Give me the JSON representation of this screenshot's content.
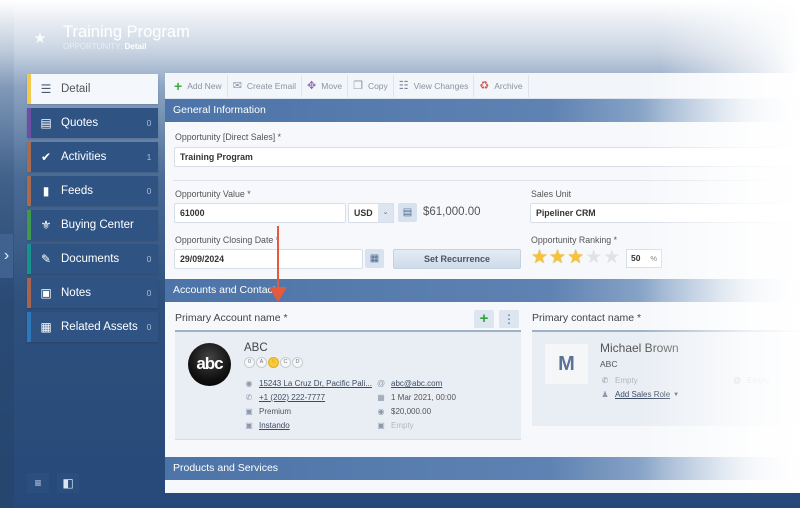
{
  "header": {
    "title": "Training Program",
    "subtitle_prefix": "OPPORTUNITY:",
    "subtitle_current": "Detail",
    "favorite_icon": "star-icon"
  },
  "sidebar": {
    "items": [
      {
        "label": "Detail",
        "count": "",
        "icon": "list-icon",
        "accent": "#f2c94c",
        "active": true
      },
      {
        "label": "Quotes",
        "count": "0",
        "icon": "quote-icon",
        "accent": "#6c4fa3"
      },
      {
        "label": "Activities",
        "count": "1",
        "icon": "chat-icon",
        "accent": "#a86b4f"
      },
      {
        "label": "Feeds",
        "count": "0",
        "icon": "feeds-icon",
        "accent": "#a86b4f"
      },
      {
        "label": "Buying Center",
        "count": "",
        "icon": "org-chart-icon",
        "accent": "#3f9a4d"
      },
      {
        "label": "Documents",
        "count": "0",
        "icon": "document-icon",
        "accent": "#16938d"
      },
      {
        "label": "Notes",
        "count": "0",
        "icon": "note-icon",
        "accent": "#a8644f"
      },
      {
        "label": "Related Assets",
        "count": "0",
        "icon": "assets-icon",
        "accent": "#2d78bd"
      }
    ],
    "bottom_icons": [
      "list-view-icon",
      "layout-edit-icon"
    ]
  },
  "toolbar": {
    "buttons": [
      {
        "label": "Add New",
        "icon": "plus-icon"
      },
      {
        "label": "Create Email",
        "icon": "email-icon"
      },
      {
        "label": "Move",
        "icon": "move-icon"
      },
      {
        "label": "Copy",
        "icon": "copy-icon"
      },
      {
        "label": "View Changes",
        "icon": "view-changes-icon"
      },
      {
        "label": "Archive",
        "icon": "archive-icon"
      }
    ]
  },
  "sections": {
    "general": "General Information",
    "accounts": "Accounts and Contacts",
    "products": "Products and Services"
  },
  "form": {
    "opportunity_label": "Opportunity [Direct Sales] *",
    "opportunity_value": "Training Program",
    "value_label": "Opportunity Value *",
    "value": "61000",
    "currency": "USD",
    "formatted_value": "$61,000.00",
    "sales_unit_label": "Sales Unit",
    "sales_unit": "Pipeliner CRM",
    "closing_date_label": "Opportunity Closing Date *",
    "closing_date": "29/09/2024",
    "set_recurrence": "Set Recurrence",
    "ranking_label": "Opportunity Ranking *",
    "ranking_stars_filled": 3,
    "ranking_stars_total": 5,
    "ranking_value": "50",
    "ranking_unit": "%"
  },
  "account": {
    "label": "Primary Account name *",
    "logo_text": "abc",
    "name": "ABC",
    "grades": [
      "0",
      "A",
      "B",
      "C",
      "D"
    ],
    "selected_grade": "B",
    "address": "15243 La Cruz Dr, Pacific Pali...",
    "phone": "+1 (202) 222-7777",
    "type": "Premium",
    "owner": "Instando",
    "email": "abc@abc.com",
    "date": "1 Mar 2021, 00:00",
    "revenue": "$20,000.00",
    "extra": "Empty"
  },
  "contact": {
    "label": "Primary contact name *",
    "initial": "M",
    "name": "Michael Brown",
    "company": "ABC",
    "phone": "Empty",
    "email": "Empty",
    "sales_role": "Add Sales Role"
  }
}
